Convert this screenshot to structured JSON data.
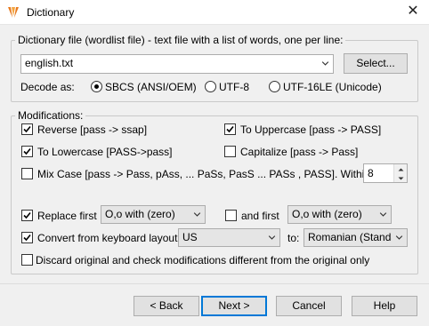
{
  "window": {
    "title": "Dictionary",
    "close_glyph": "✕",
    "icon": "app-logo-icon"
  },
  "file_group": {
    "label": "Dictionary file (wordlist file) - text file with a list of words, one per line:",
    "file_value": "english.txt",
    "select_button": "Select...",
    "decode_label": "Decode as:",
    "decode_options": [
      {
        "label": "SBCS (ANSI/OEM)",
        "selected": true
      },
      {
        "label": "UTF-8",
        "selected": false
      },
      {
        "label": "UTF-16LE (Unicode)",
        "selected": false
      }
    ]
  },
  "modifications": {
    "label": "Modifications:",
    "reverse": {
      "label": "Reverse [pass -> ssap]",
      "checked": true
    },
    "to_uppercase": {
      "label": "To Uppercase [pass -> PASS]",
      "checked": true
    },
    "to_lowercase": {
      "label": "To Lowercase [PASS->pass]",
      "checked": true
    },
    "capitalize": {
      "label": "Capitalize [pass -> Pass]",
      "checked": false
    },
    "mix_case": {
      "label": "Mix Case [pass -> Pass, pAss, ... PaSs, PasS ... PASs , PASS]. Within first:",
      "checked": false,
      "value": "8"
    },
    "replace_first": {
      "label": "Replace first",
      "checked": true,
      "option": "O,o with (zero)"
    },
    "and_first": {
      "label": "and first",
      "checked": false,
      "option": "O,o with (zero)"
    },
    "convert_layout": {
      "label": "Convert from keyboard layout:",
      "checked": true,
      "from": "US",
      "to_label": "to:",
      "to": "Romanian (Standard)"
    },
    "discard": {
      "label": "Discard original and check modifications different from the original only",
      "checked": false
    }
  },
  "footer": {
    "back": "< Back",
    "next": "Next >",
    "cancel": "Cancel",
    "help": "Help"
  }
}
